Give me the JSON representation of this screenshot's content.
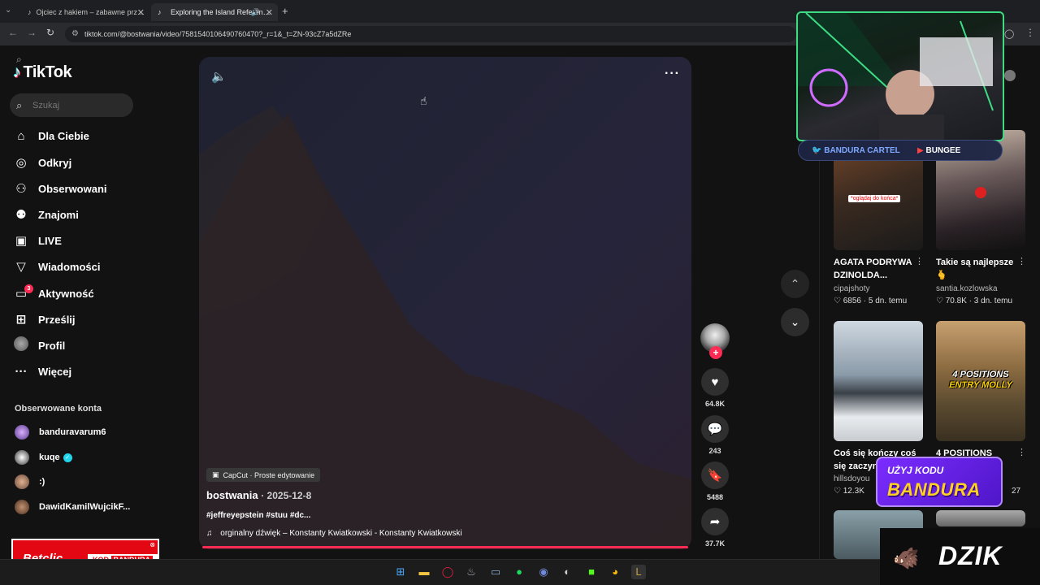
{
  "browser": {
    "tabs": [
      {
        "title": "Ojciec z hakiem – zabawne prz…",
        "active": false
      },
      {
        "title": "Exploring the Island Referen…",
        "active": true
      }
    ],
    "url": "tiktok.com/@bostwania/video/7581540106490760470?_r=1&_t=ZN-93cZ7a5dZRe"
  },
  "sidebar": {
    "logo": "TikTok",
    "search_placeholder": "Szukaj",
    "nav": [
      {
        "label": "Dla Ciebie",
        "icon": "home-icon"
      },
      {
        "label": "Odkryj",
        "icon": "compass-icon"
      },
      {
        "label": "Obserwowani",
        "icon": "following-icon"
      },
      {
        "label": "Znajomi",
        "icon": "friends-icon"
      },
      {
        "label": "LIVE",
        "icon": "live-icon"
      },
      {
        "label": "Wiadomości",
        "icon": "messages-icon"
      },
      {
        "label": "Aktywność",
        "icon": "activity-icon",
        "badge": "3"
      },
      {
        "label": "Prześlij",
        "icon": "upload-icon"
      },
      {
        "label": "Profil",
        "icon": "profile-avatar"
      },
      {
        "label": "Więcej",
        "icon": "more-icon"
      }
    ],
    "followed_title": "Obserwowane konta",
    "followed": [
      {
        "name": "banduravarum6"
      },
      {
        "name": "kuqe",
        "verified": true
      },
      {
        "name": ":)"
      },
      {
        "name": "DawidKamilWujcikF..."
      }
    ]
  },
  "ad_betclic": {
    "brand": "Betclic",
    "code_label": "KOD",
    "code": "BANDURA"
  },
  "video": {
    "capcut_label": "CapCut · Proste edytowanie",
    "author": "bostwania",
    "date": "2025-12-8",
    "tags": "#jeffreyepstein #stuu #dc...",
    "sound": "orginalny dźwięk – Konstanty Kwiatkowski - Konstanty Kwiatkowski",
    "likes": "64.8K",
    "comments": "243",
    "saves": "5488",
    "shares": "37.7K"
  },
  "recommended": [
    {
      "title": "AGATA PODRYWA DZINOLDA...",
      "user": "cipajshoty",
      "likes": "6856",
      "age": "5 dn. temu",
      "overlay": "*oglądaj do końca*"
    },
    {
      "title": "Takie są najlepsze 🫰",
      "user": "santia.kozlowska",
      "likes": "70.8K",
      "age": "3 dn. temu"
    },
    {
      "title": "Coś się kończy coś się zaczyn",
      "user": "hillsdoyou",
      "likes": "12.3K",
      "age": ""
    },
    {
      "title": "4 POSITIONS",
      "user": "",
      "likes": "",
      "age": "27",
      "overlay_1": "4 POSITIONS",
      "overlay_2": "ENTRY MOLLY"
    }
  ],
  "stream_overlay": {
    "twitter": "BANDURA CARTEL",
    "youtube": "BUNGEE",
    "promo_line1": "UŻYJ KODU",
    "promo_line2": "BANDURA",
    "sponsor": "DZIK"
  },
  "colors": {
    "accent": "#fe2c55",
    "bg": "#121212",
    "panel": "#2f2f2f"
  }
}
